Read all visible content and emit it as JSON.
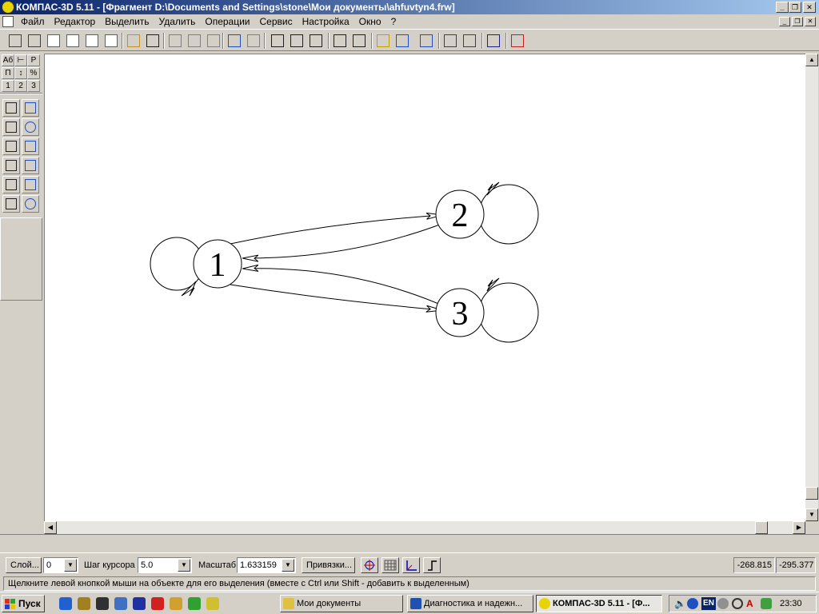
{
  "window": {
    "title": "КОМПАС-3D 5.11 - [Фрагмент D:\\Documents and Settings\\stone\\Мои документы\\ahfuvtyn4.frw]"
  },
  "menu": [
    "Файл",
    "Редактор",
    "Выделить",
    "Удалить",
    "Операции",
    "Сервис",
    "Настройка",
    "Окно",
    "?"
  ],
  "toolbar_icons": [
    "new-fragment-icon",
    "new-detail-icon",
    "new-sheet-icon",
    "new-doc-icon",
    "new-spec-icon",
    "new-text-icon",
    "open-icon",
    "save-icon",
    "cut-icon",
    "copy-icon",
    "paste-icon",
    "undo-icon",
    "redo-icon",
    "zoom-window-icon",
    "zoom-in-icon",
    "zoom-out-icon",
    "pan-icon",
    "zoom-all-icon",
    "edit-icon",
    "view-icon",
    "properties-icon",
    "print-preview-icon",
    "print-icon",
    "help-icon",
    "exit-icon"
  ],
  "palette": {
    "top_row1": [
      "Аб",
      "⊢",
      "Р"
    ],
    "top_row2": [
      "П",
      "↕",
      "%"
    ],
    "top_row3": [
      "1",
      "2",
      "3"
    ]
  },
  "graph": {
    "nodes": [
      {
        "label": "1"
      },
      {
        "label": "2"
      },
      {
        "label": "3"
      }
    ]
  },
  "bottom": {
    "layer_button": "Слой...",
    "layer_value": "0",
    "step_label": "Шаг курсора",
    "step_value": "5.0",
    "scale_label": "Масштаб",
    "scale_value": "1.633159",
    "snaps_button": "Привязки...",
    "coord_x": "-268.815",
    "coord_y": "-295.377"
  },
  "status": {
    "text": "Щелкните левой кнопкой мыши на объекте для его выделения (вместе с Ctrl или Shift - добавить к выделенным)"
  },
  "taskbar": {
    "start": "Пуск",
    "tasks": [
      {
        "label": "Мои документы",
        "active": false
      },
      {
        "label": "Диагностика и надежн...",
        "active": false
      },
      {
        "label": "КОМПАС-3D 5.11 - [Ф...",
        "active": true
      }
    ],
    "lang": "EN",
    "clock": "23:30"
  }
}
